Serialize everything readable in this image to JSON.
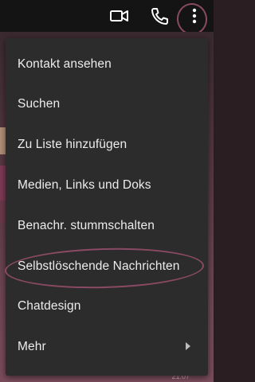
{
  "toolbar": {
    "video_icon": "video-camera-icon",
    "phone_icon": "phone-icon",
    "more_icon": "more-vertical-icon"
  },
  "background": {
    "timestamp": "21:07"
  },
  "menu": {
    "items": [
      {
        "label": "Kontakt ansehen"
      },
      {
        "label": "Suchen"
      },
      {
        "label": "Zu Liste hinzufügen"
      },
      {
        "label": "Medien, Links und Doks"
      },
      {
        "label": "Benachr. stummschalten"
      },
      {
        "label": "Selbstlöschende Nachrichten",
        "annotated": true
      },
      {
        "label": "Chatdesign"
      },
      {
        "label": "Mehr",
        "submenu": true
      }
    ]
  },
  "colors": {
    "menu_background": "#2c2c2c",
    "menu_text": "#ececec",
    "annotation": "#8a4a63",
    "topbar": "#141414"
  }
}
